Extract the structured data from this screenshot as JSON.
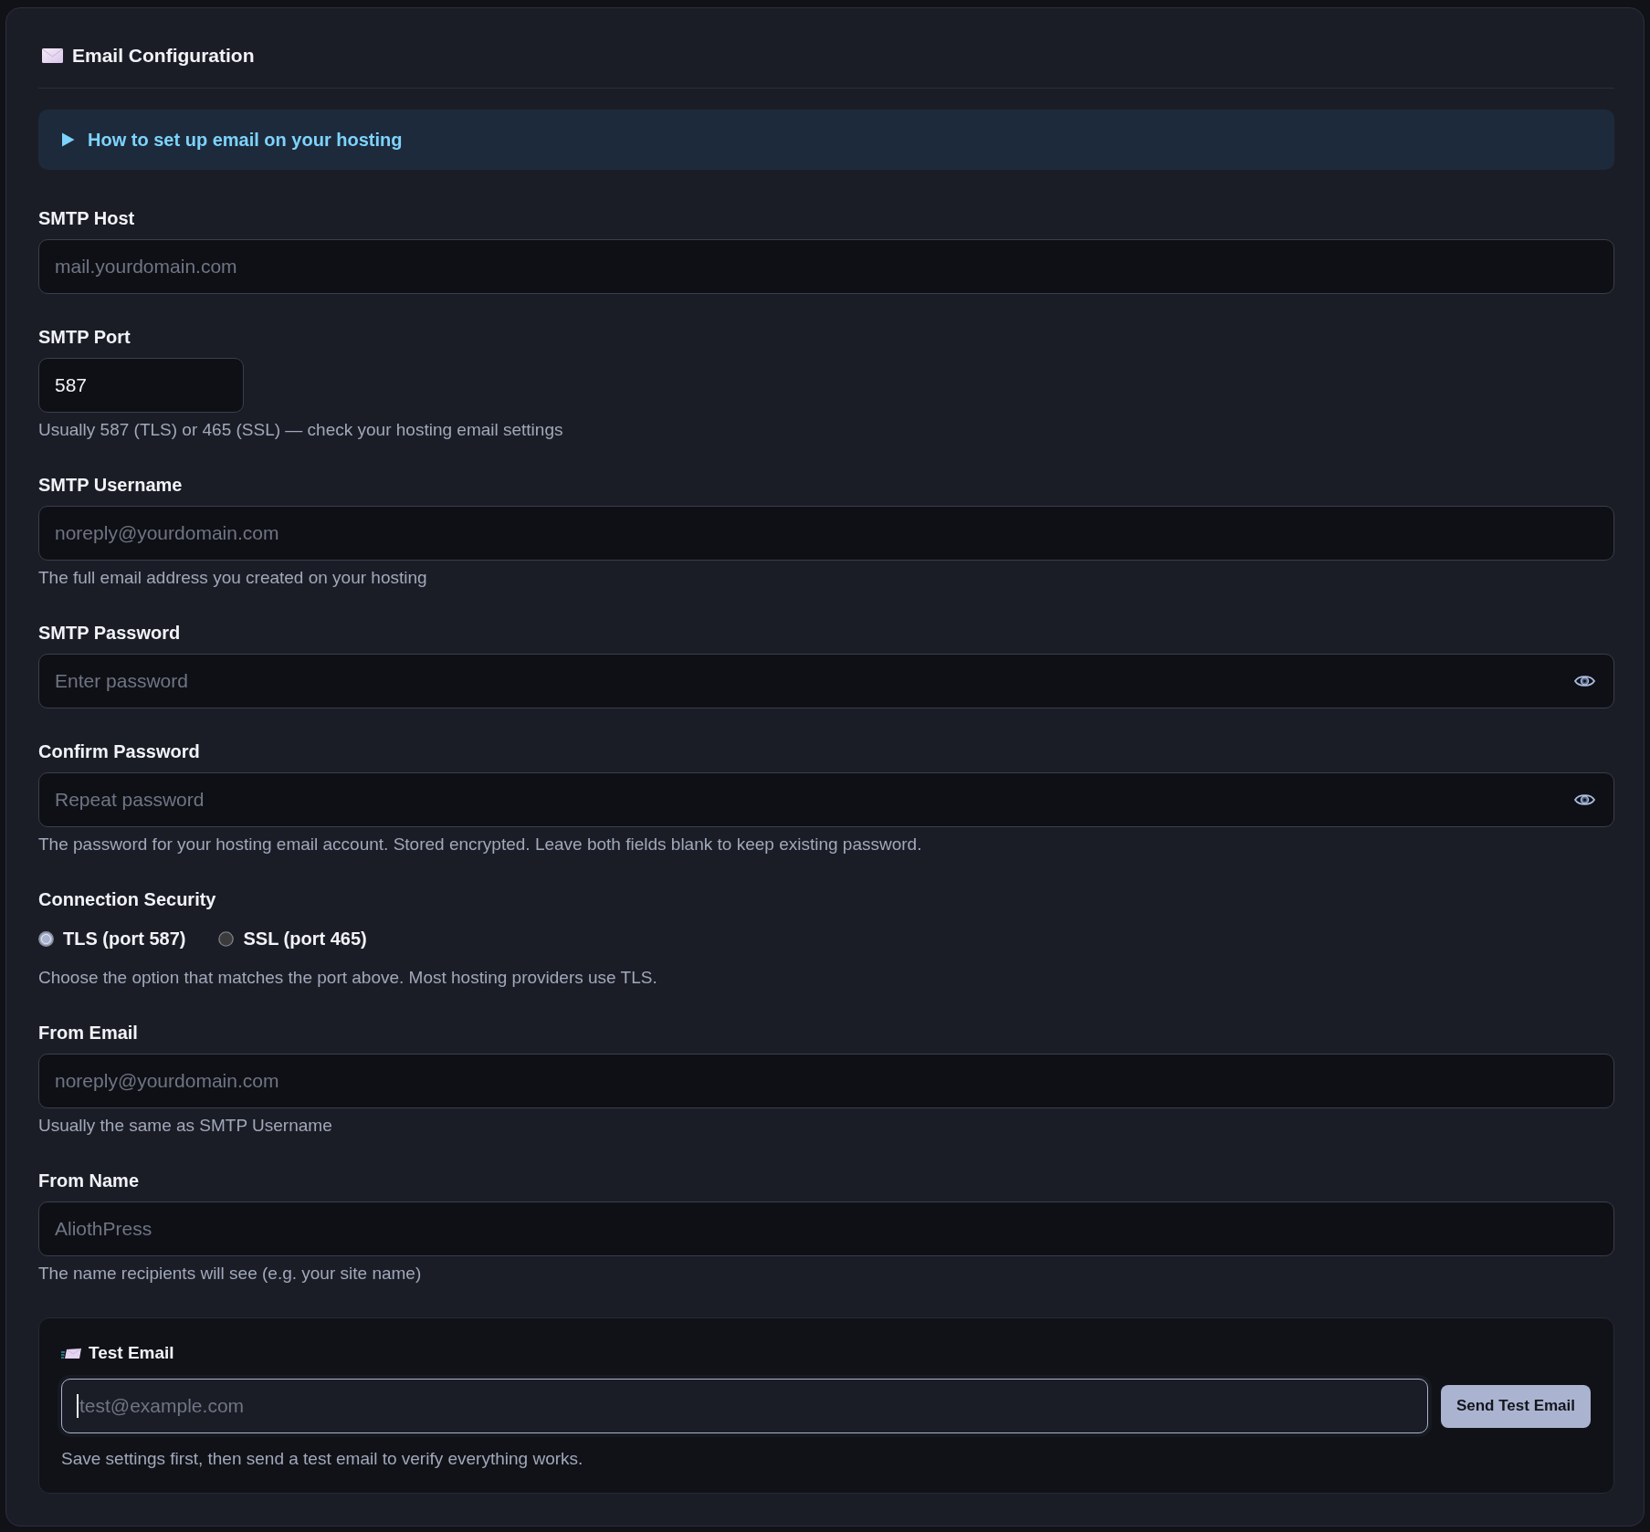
{
  "panel": {
    "title": "Email Configuration"
  },
  "help": {
    "summary": "How to set up email on your hosting",
    "expanded": false
  },
  "fields": [
    {
      "kind": "text",
      "label": "SMTP Host",
      "placeholder": "mail.yourdomain.com"
    },
    {
      "kind": "number",
      "label": "SMTP Port",
      "value": "587",
      "hint": "Usually 587 (TLS) or 465 (SSL) — check your hosting email settings"
    },
    {
      "kind": "text",
      "label": "SMTP Username",
      "placeholder": "noreply@yourdomain.com",
      "hint": "The full email address you created on your hosting"
    },
    {
      "kind": "password",
      "label": "SMTP Password",
      "placeholder": "Enter password"
    },
    {
      "kind": "password",
      "label": "Confirm Password",
      "placeholder": "Repeat password",
      "hint": "The password for your hosting email account. Stored encrypted. Leave both fields blank to keep existing password."
    },
    {
      "kind": "radio",
      "label": "Connection Security",
      "options": [
        {
          "label": "TLS (port 587)",
          "selected": true
        },
        {
          "label": "SSL (port 465)",
          "selected": false
        }
      ],
      "hint": "Choose the option that matches the port above. Most hosting providers use TLS."
    },
    {
      "kind": "text",
      "label": "From Email",
      "placeholder": "noreply@yourdomain.com",
      "hint": "Usually the same as SMTP Username"
    },
    {
      "kind": "text",
      "label": "From Name",
      "placeholder": "AliothPress",
      "hint": "The name recipients will see (e.g. your site name)"
    }
  ],
  "test_email": {
    "title": "Test Email",
    "placeholder": "test@example.com",
    "focused": true,
    "button": "Send Test Email",
    "hint": "Save settings first, then send a test email to verify everything works."
  }
}
